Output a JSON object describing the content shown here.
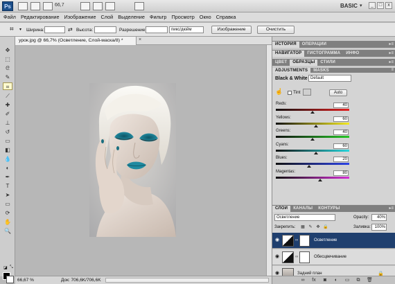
{
  "app": {
    "logo": "Ps",
    "zoom": "66,7",
    "workspace": "BASIC",
    "window_controls": [
      "_",
      "□",
      "x"
    ]
  },
  "menu": [
    "Файл",
    "Редактирование",
    "Изображение",
    "Слой",
    "Выделение",
    "Фильтр",
    "Просмотр",
    "Окно",
    "Справка"
  ],
  "options": {
    "width_label": "Ширина:",
    "height_label": "Высота:",
    "resolution_label": "Разрешение:",
    "resolution_unit": "пикс/дюйм",
    "image_button": "Изображение",
    "clear_button": "Очистить"
  },
  "document": {
    "tab_title": "урок.jpg @ 66,7% (Осветление, Слой-маска/8) *",
    "close": "×",
    "status_zoom": "66,67 %",
    "status_doc": "Док: 706,6K/706,6K"
  },
  "panels": {
    "group1_tabs": [
      "ИСТОРИЯ",
      "ОПЕРАЦИИ"
    ],
    "group2_tabs": [
      "НАВИГАТОР",
      "ГИСТОГРАММА",
      "ИНФО"
    ],
    "group3_tabs": [
      "ЦВЕТ",
      "ОБРАЗЦЫ",
      "СТИЛИ"
    ],
    "group4_tabs": [
      "ADJUSTMENTS",
      "MASKS"
    ],
    "layers_tabs": [
      "СЛОИ",
      "КАНАЛЫ",
      "КОНТУРЫ"
    ]
  },
  "adjustments": {
    "title": "Black & White",
    "preset": "Default",
    "tint_label": "Tint",
    "auto_button": "Auto",
    "sliders": [
      {
        "label": "Reds:",
        "value": "40",
        "fraction": 0.5
      },
      {
        "label": "Yellows:",
        "value": "60",
        "fraction": 0.55
      },
      {
        "label": "Greens:",
        "value": "40",
        "fraction": 0.5
      },
      {
        "label": "Cyans:",
        "value": "60",
        "fraction": 0.55
      },
      {
        "label": "Blues:",
        "value": "20",
        "fraction": 0.45
      },
      {
        "label": "Magentas:",
        "value": "80",
        "fraction": 0.6
      }
    ]
  },
  "layers": {
    "blend_mode": "Осветление",
    "opacity_label": "Opacity:",
    "opacity_value": "40%",
    "lock_label": "Закрепить:",
    "fill_label": "Заливка:",
    "fill_value": "100%",
    "items": [
      {
        "name": "Осветление",
        "selected": true
      },
      {
        "name": "Обесцвечивание",
        "selected": false
      },
      {
        "name": "Задний план",
        "selected": false
      }
    ]
  },
  "colors": {
    "accent": "#1f3f6e",
    "panel_tab": "#7f7f7f",
    "makeup_teal": "#1d7f92"
  }
}
